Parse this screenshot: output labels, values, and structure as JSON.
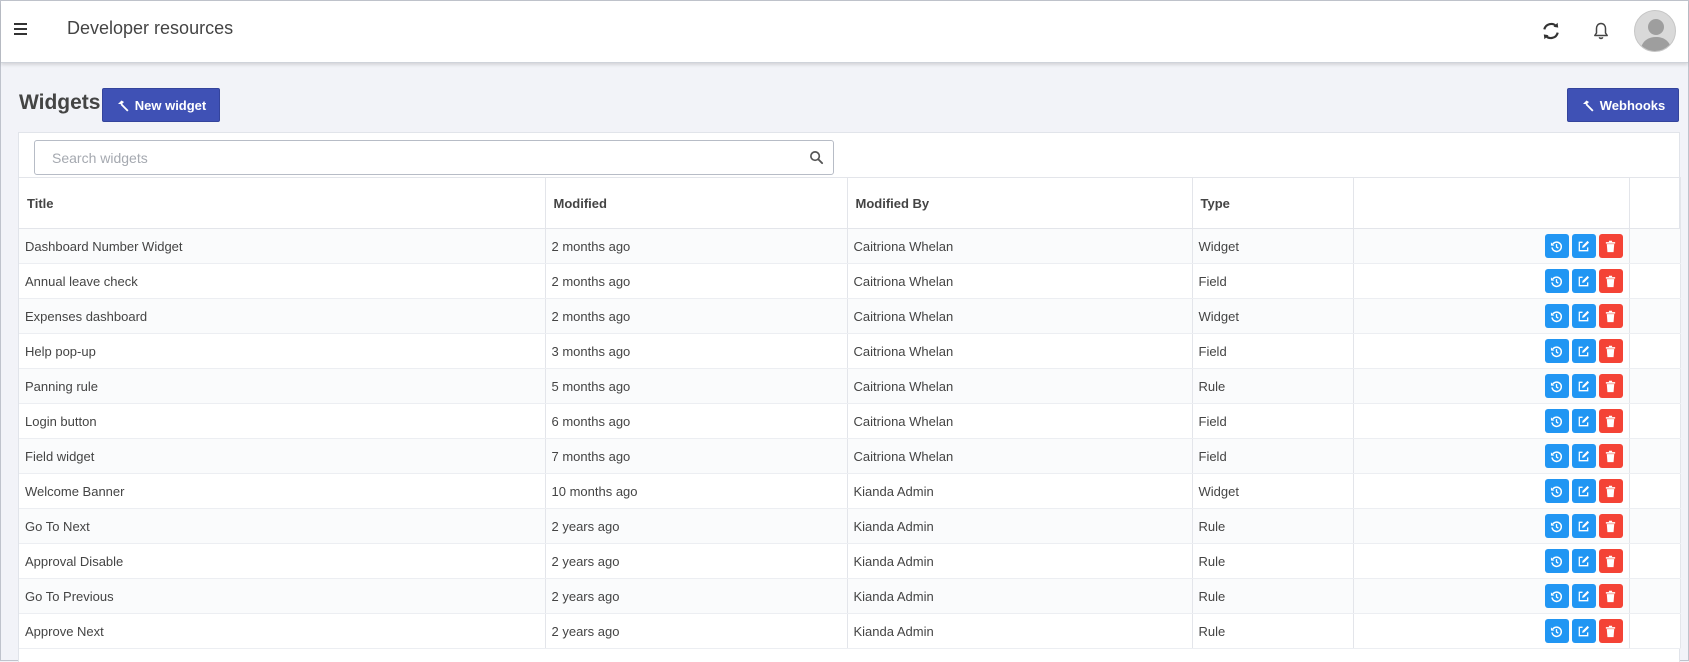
{
  "header": {
    "title": "Developer resources"
  },
  "page": {
    "heading": "Widgets",
    "new_button_label": "New widget",
    "webhooks_button_label": "Webhooks"
  },
  "search": {
    "placeholder": "Search widgets",
    "value": ""
  },
  "table": {
    "columns": [
      "Title",
      "Modified",
      "Modified By",
      "Type",
      ""
    ],
    "rows": [
      {
        "title": "Dashboard Number Widget",
        "modified": "2 months ago",
        "modified_by": "Caitriona Whelan",
        "type": "Widget"
      },
      {
        "title": "Annual leave check",
        "modified": "2 months ago",
        "modified_by": "Caitriona Whelan",
        "type": "Field"
      },
      {
        "title": "Expenses dashboard",
        "modified": "2 months ago",
        "modified_by": "Caitriona Whelan",
        "type": "Widget"
      },
      {
        "title": "Help pop-up",
        "modified": "3 months ago",
        "modified_by": "Caitriona Whelan",
        "type": "Field"
      },
      {
        "title": "Panning rule",
        "modified": "5 months ago",
        "modified_by": "Caitriona Whelan",
        "type": "Rule"
      },
      {
        "title": "Login button",
        "modified": "6 months ago",
        "modified_by": "Caitriona Whelan",
        "type": "Field"
      },
      {
        "title": "Field widget",
        "modified": "7 months ago",
        "modified_by": "Caitriona Whelan",
        "type": "Field"
      },
      {
        "title": "Welcome Banner",
        "modified": "10 months ago",
        "modified_by": "Kianda Admin",
        "type": "Widget"
      },
      {
        "title": "Go To Next",
        "modified": "2 years ago",
        "modified_by": "Kianda Admin",
        "type": "Rule"
      },
      {
        "title": "Approval Disable",
        "modified": "2 years ago",
        "modified_by": "Kianda Admin",
        "type": "Rule"
      },
      {
        "title": "Go To Previous",
        "modified": "2 years ago",
        "modified_by": "Kianda Admin",
        "type": "Rule"
      },
      {
        "title": "Approve Next",
        "modified": "2 years ago",
        "modified_by": "Kianda Admin",
        "type": "Rule"
      }
    ]
  },
  "icons": {
    "menu": "hamburger-menu-icon",
    "refresh": "refresh-icon",
    "notifications": "bell-icon",
    "avatar": "user-avatar",
    "search": "search-icon",
    "button": "hammer-icon",
    "row_actions": [
      "history-icon",
      "edit-icon",
      "trash-icon"
    ]
  },
  "colors": {
    "primary": "#3f51b5",
    "action_blue": "#2196f3",
    "action_red": "#f44336"
  }
}
